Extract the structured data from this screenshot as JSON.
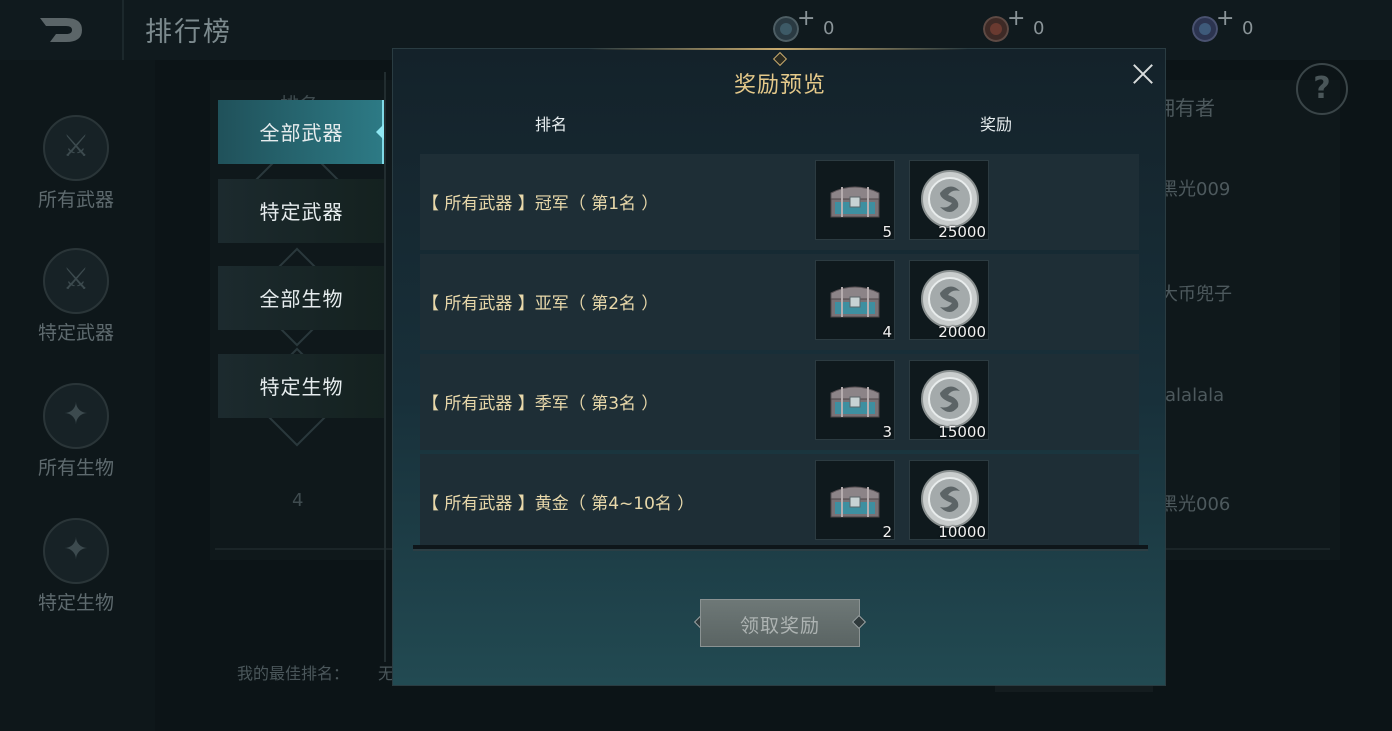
{
  "header": {
    "title": "排行榜",
    "currencies": [
      {
        "icon": "blue-gem-currency-icon",
        "value": "0"
      },
      {
        "icon": "red-gem-currency-icon",
        "value": "0"
      },
      {
        "icon": "purple-gem-currency-icon",
        "value": "0"
      }
    ]
  },
  "sidebar": {
    "items": [
      {
        "label": "所有武器",
        "icon": "sword-icon"
      },
      {
        "label": "特定武器",
        "icon": "sword-icon"
      },
      {
        "label": "所有生物",
        "icon": "creature-icon"
      },
      {
        "label": "特定生物",
        "icon": "creature-icon"
      }
    ]
  },
  "tabs": [
    {
      "label": "全部武器",
      "active": true
    },
    {
      "label": "特定武器",
      "active": false
    },
    {
      "label": "全部生物",
      "active": false
    },
    {
      "label": "特定生物",
      "active": false
    }
  ],
  "background": {
    "rank_header": "排名",
    "owner_header": "拥有者",
    "owners": [
      "黑光009",
      "大币兜子",
      "lalalala",
      "黑光006"
    ],
    "rank_row": "4",
    "best_rank_label": "我的最佳排名：",
    "best_rank_value": "无"
  },
  "modal": {
    "title": "奖励预览",
    "col_rank": "排名",
    "col_reward": "奖励",
    "rows": [
      {
        "label": "【 所有武器 】冠军（ 第1名 ）",
        "chest_qty": "5",
        "coin_qty": "25000"
      },
      {
        "label": "【 所有武器 】亚军（ 第2名 ）",
        "chest_qty": "4",
        "coin_qty": "20000"
      },
      {
        "label": "【 所有武器 】季军（ 第3名 ）",
        "chest_qty": "3",
        "coin_qty": "15000"
      },
      {
        "label": "【 所有武器 】黄金（ 第4~10名 ）",
        "chest_qty": "2",
        "coin_qty": "10000"
      }
    ],
    "claim_button": "领取奖励"
  },
  "colors": {
    "accent_gold": "#e4c98a",
    "tab_active": "#2d7a85",
    "modal_bg": "#18303a"
  }
}
